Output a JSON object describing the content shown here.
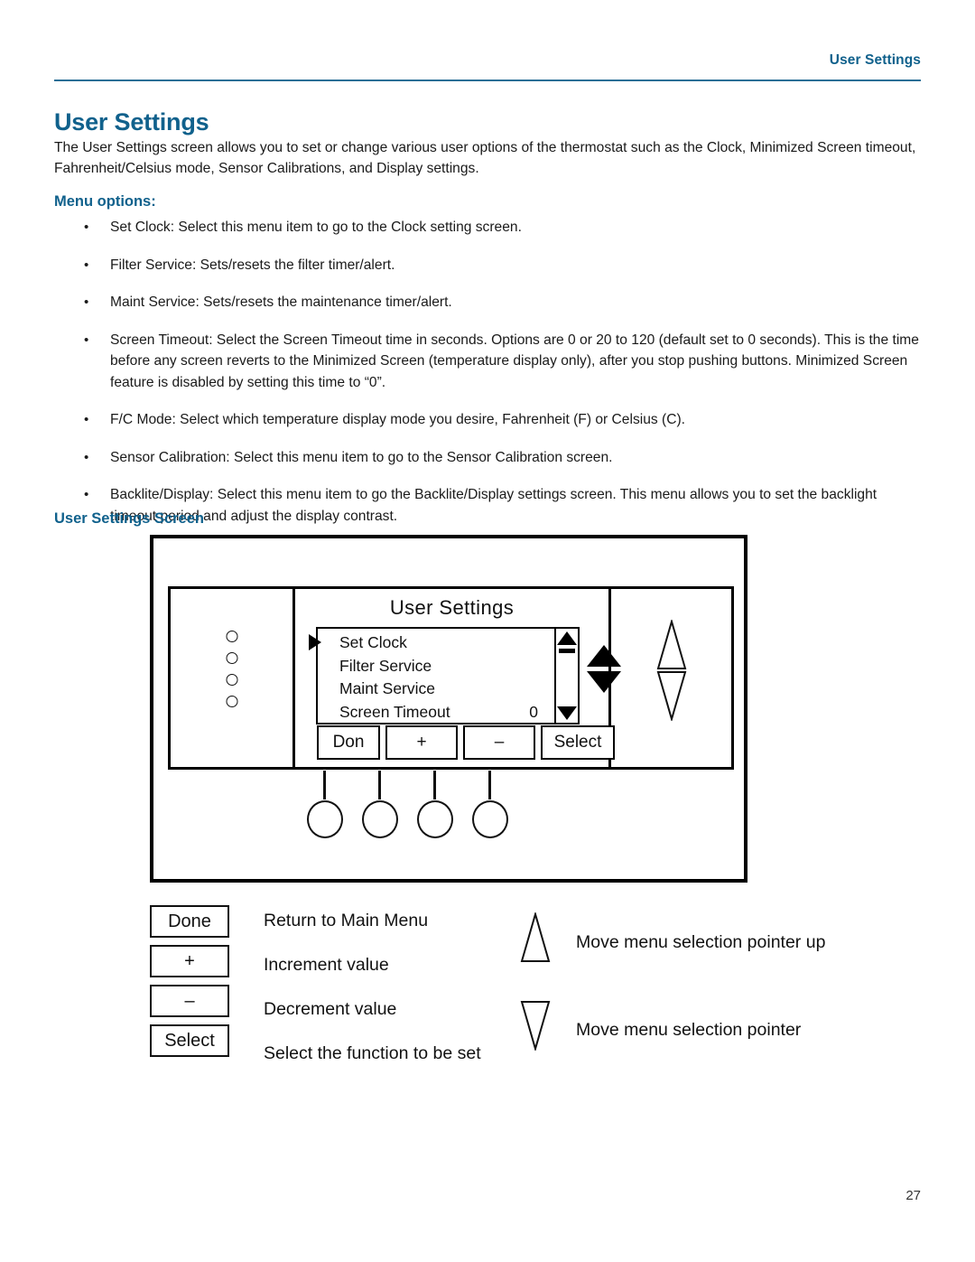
{
  "header": {
    "running_head": "User Settings"
  },
  "title": "User Settings",
  "intro": "The User Settings screen allows you to set or change various user options of the thermostat such as the Clock, Minimized Screen timeout, Fahrenheit/Celsius mode, Sensor Calibrations, and Display settings.",
  "menu_options_heading": "Menu options:",
  "bullet_marker": "•",
  "bullets": [
    "Set Clock:  Select this menu item to go to the Clock setting screen.",
    "Filter Service: Sets/resets the filter timer/alert.",
    "Maint Service: Sets/resets the maintenance timer/alert.",
    "Screen Timeout: Select the Screen Timeout time in seconds. Options are 0 or 20 to 120 (default set to 0 seconds). This is the time before any screen reverts to the Minimized Screen (temperature display only), after you stop pushing buttons.  Minimized Screen feature is disabled by setting this time to “0”.",
    "F/C Mode: Select which temperature display mode you desire, Fahrenheit (F) or Celsius (C).",
    "Sensor Calibration: Select this menu item to go to the Sensor Calibration screen.",
    "Backlite/Display: Select this menu item to go the Backlite/Display settings screen.  This menu allows you to set the backlight timeout period and adjust the display contrast."
  ],
  "screen_section_heading": "User Settings Screen",
  "device": {
    "lcd_title": "User Settings",
    "menu_items": [
      {
        "label": "Set Clock",
        "value": "",
        "selected": true
      },
      {
        "label": "Filter Service",
        "value": "",
        "selected": false
      },
      {
        "label": "Maint Service",
        "value": "",
        "selected": false
      },
      {
        "label": "Screen Timeout",
        "value": "0",
        "selected": false
      }
    ],
    "softkeys": [
      {
        "name": "done",
        "label": "Don"
      },
      {
        "name": "increment",
        "label": "+"
      },
      {
        "name": "decrement",
        "label": "–"
      },
      {
        "name": "select",
        "label": "Select"
      }
    ],
    "led_count": 4,
    "hard_button_count": 4
  },
  "legend": {
    "keys": [
      {
        "label": "Done",
        "description": "Return to Main Menu"
      },
      {
        "label": "+",
        "description": "Increment value"
      },
      {
        "label": "–",
        "description": "Decrement value"
      },
      {
        "label": "Select",
        "description": "Select the function to be set"
      }
    ],
    "arrows": [
      {
        "icon": "triangle-up-outline",
        "description": "Move menu selection pointer up"
      },
      {
        "icon": "triangle-down-outline",
        "description": "Move menu selection pointer"
      }
    ]
  },
  "page_number": "27",
  "colors": {
    "accent": "#10618c",
    "rule": "#2a6f96",
    "body_text": "#1a1a1a"
  }
}
